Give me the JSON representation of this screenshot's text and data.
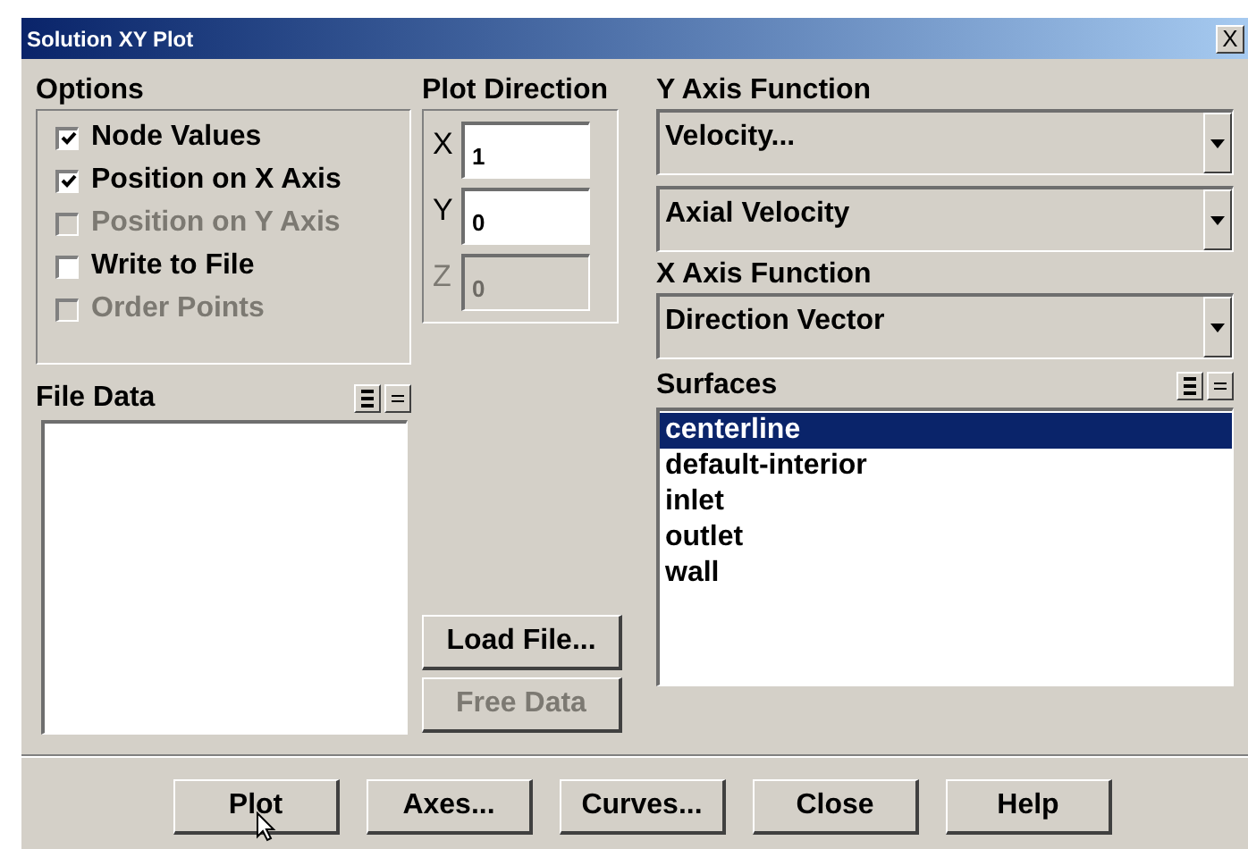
{
  "window": {
    "title": "Solution XY Plot",
    "close": "X"
  },
  "options": {
    "title": "Options",
    "items": [
      {
        "label": "Node Values",
        "checked": true,
        "disabled": false
      },
      {
        "label": "Position on X Axis",
        "checked": true,
        "disabled": false
      },
      {
        "label": "Position on Y Axis",
        "checked": false,
        "disabled": true
      },
      {
        "label": "Write to File",
        "checked": false,
        "disabled": false
      },
      {
        "label": "Order Points",
        "checked": false,
        "disabled": true
      }
    ]
  },
  "plot_direction": {
    "title": "Plot Direction",
    "fields": [
      {
        "label": "X",
        "value": "1",
        "disabled": false
      },
      {
        "label": "Y",
        "value": "0",
        "disabled": false
      },
      {
        "label": "Z",
        "value": "0",
        "disabled": true
      }
    ]
  },
  "y_axis_function": {
    "title": "Y Axis Function",
    "dropdowns": [
      "Velocity...",
      "Axial Velocity"
    ]
  },
  "x_axis_function": {
    "title": "X Axis Function",
    "dropdowns": [
      "Direction Vector"
    ]
  },
  "file_data": {
    "title": "File Data"
  },
  "file_buttons": [
    {
      "label": "Load File...",
      "disabled": false
    },
    {
      "label": "Free Data",
      "disabled": true
    }
  ],
  "surfaces": {
    "title": "Surfaces",
    "items": [
      {
        "label": "centerline",
        "selected": true
      },
      {
        "label": "default-interior",
        "selected": false
      },
      {
        "label": "inlet",
        "selected": false
      },
      {
        "label": "outlet",
        "selected": false
      },
      {
        "label": "wall",
        "selected": false
      }
    ]
  },
  "buttons": [
    "Plot",
    "Axes...",
    "Curves...",
    "Close",
    "Help"
  ]
}
